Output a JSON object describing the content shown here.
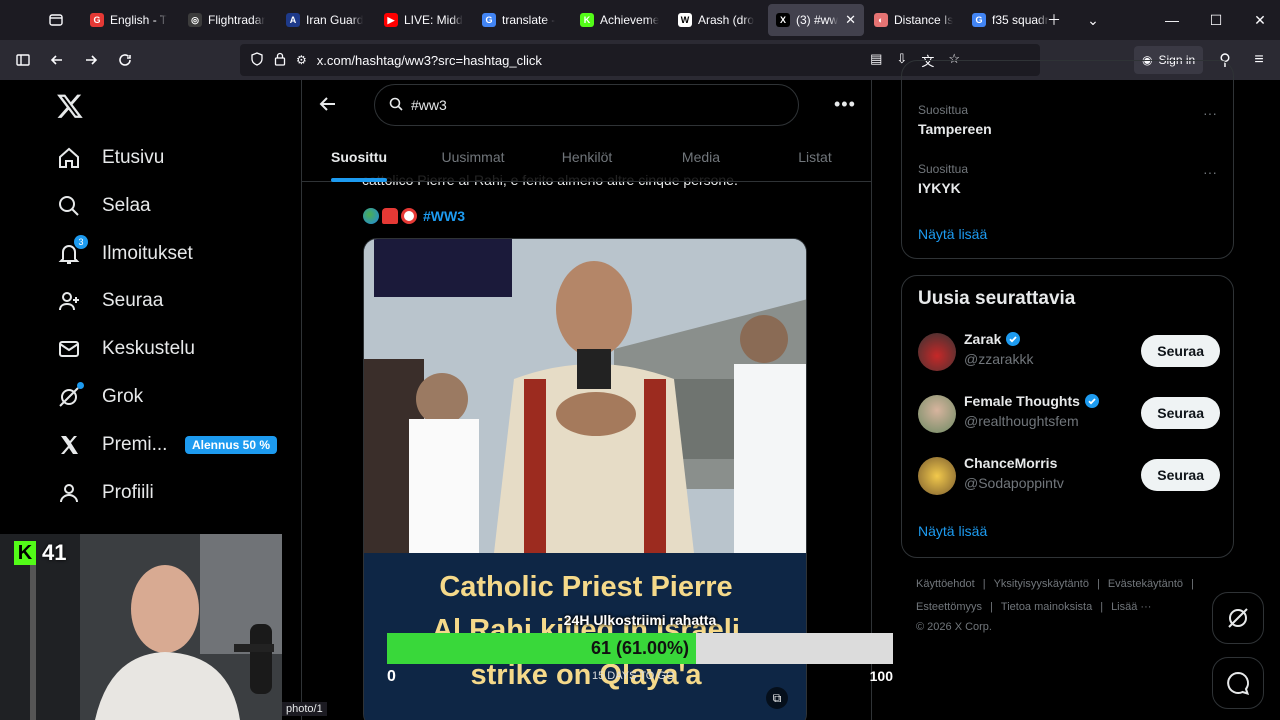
{
  "browser": {
    "tabs": [
      {
        "label": "English - T",
        "color": "#e53935",
        "glyph": "G"
      },
      {
        "label": "Flightradar",
        "color": "#3c3c3c",
        "glyph": "◎"
      },
      {
        "label": "Iran Guard",
        "color": "#1e3a8a",
        "glyph": "A"
      },
      {
        "label": "LIVE: Midd",
        "color": "#ff0000",
        "glyph": "▶"
      },
      {
        "label": "translate -",
        "color": "#4285f4",
        "glyph": "G"
      },
      {
        "label": "Achieveme",
        "color": "#53fc18",
        "glyph": "K"
      },
      {
        "label": "Arash (dro",
        "color": "#ffffff",
        "glyph": "W"
      },
      {
        "label": "(3) #ww",
        "color": "#000000",
        "glyph": "X"
      },
      {
        "label": "Distance Is",
        "color": "#e57373",
        "glyph": "◐"
      },
      {
        "label": "f35 squadr",
        "color": "#4285f4",
        "glyph": "G"
      }
    ],
    "url": "x.com/hashtag/ww3?src=hashtag_click",
    "sign_in": "Sign in"
  },
  "nav": {
    "items": [
      {
        "label": "Etusivu"
      },
      {
        "label": "Selaa"
      },
      {
        "label": "Ilmoitukset",
        "badge": "3"
      },
      {
        "label": "Seuraa"
      },
      {
        "label": "Keskustelu"
      },
      {
        "label": "Grok"
      },
      {
        "label": "Premi..."
      },
      {
        "label": "Profiili"
      }
    ],
    "promo": "Alennus 50 %"
  },
  "search": {
    "query": "#ww3"
  },
  "page_tabs": [
    "Suosittu",
    "Uusimmat",
    "Henkilöt",
    "Media",
    "Listat"
  ],
  "tweet": {
    "cut_text": "cattolico Pierre al-Rahi, e ferito almeno altre cinque persone.",
    "hashtag": "#WW3",
    "caption": [
      "Catholic Priest Pierre",
      "Al Rahi killed in Israeli",
      "strike on Qlaya'a"
    ]
  },
  "trends": [
    {
      "context": "Suosittua",
      "name": "Tampereen"
    },
    {
      "context": "Suosittua",
      "name": "IYKYK"
    }
  ],
  "trends_more": "Näytä lisää",
  "who_to_follow": {
    "title": "Uusia seurattavia",
    "accounts": [
      {
        "name": "Zarak",
        "handle": "@zzarakkk",
        "verified": true,
        "button": "Seuraa"
      },
      {
        "name": "Female Thoughts",
        "handle": "@realthoughtsfem",
        "verified": true,
        "button": "Seuraa"
      },
      {
        "name": "ChanceMorris",
        "handle": "@Sodapoppintv",
        "verified": false,
        "button": "Seuraa"
      }
    ],
    "more": "Näytä lisää"
  },
  "footer": {
    "row1": [
      "Käyttöehdot",
      "|",
      "Yksityisyyskäytäntö",
      "|",
      "Evästekäytäntö",
      "|"
    ],
    "row2": [
      "Esteettömyys",
      "|",
      "Tietoa mainoksista",
      "|",
      "Lisää ···"
    ],
    "copyright": "© 2026 X Corp."
  },
  "overlay": {
    "kick_count": "41",
    "photo_url": "photo/1",
    "goal_title": "24H Ulkostriimi rahatta",
    "goal_value": 61,
    "goal_max": 100,
    "goal_label": "61 (61.00%)",
    "goal_min_label": "0",
    "goal_max_label": "100",
    "goal_days": "15 DAYS TO GO"
  },
  "colors": {
    "accent": "#1d9bf0",
    "goal_fill": "#39d83a",
    "background": "#000000"
  }
}
